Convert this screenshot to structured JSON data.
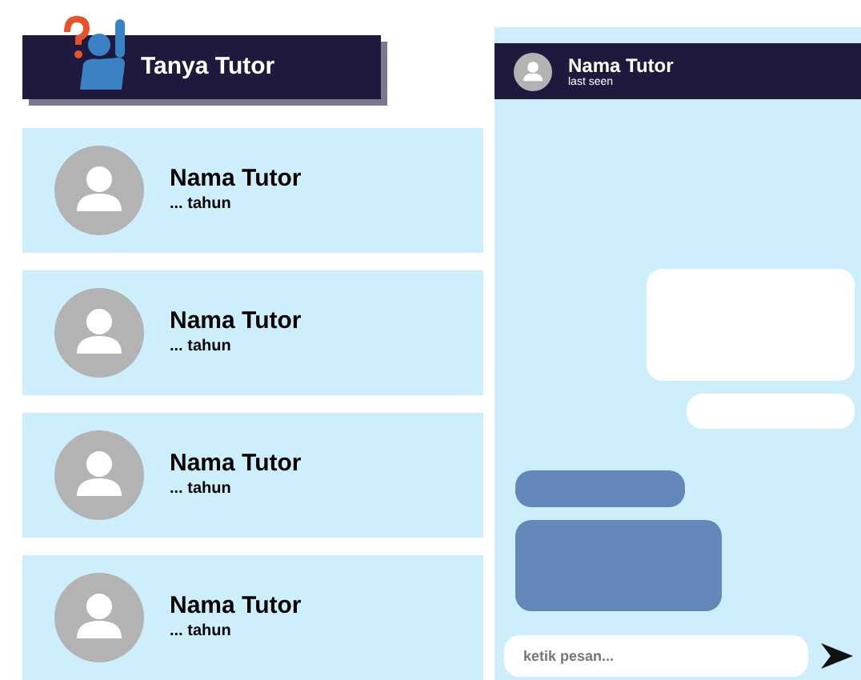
{
  "header": {
    "title": "Tanya Tutor"
  },
  "tutors": [
    {
      "name": "Nama Tutor",
      "age": "... tahun"
    },
    {
      "name": "Nama Tutor",
      "age": "... tahun"
    },
    {
      "name": "Nama Tutor",
      "age": "... tahun"
    },
    {
      "name": "Nama Tutor",
      "age": "... tahun"
    }
  ],
  "chat": {
    "name": "Nama Tutor",
    "status": "last seen",
    "messages": [
      {
        "kind": "outgoing"
      },
      {
        "kind": "outgoing"
      },
      {
        "kind": "incoming"
      },
      {
        "kind": "incoming"
      }
    ],
    "input": {
      "placeholder": "ketik pesan..."
    }
  }
}
